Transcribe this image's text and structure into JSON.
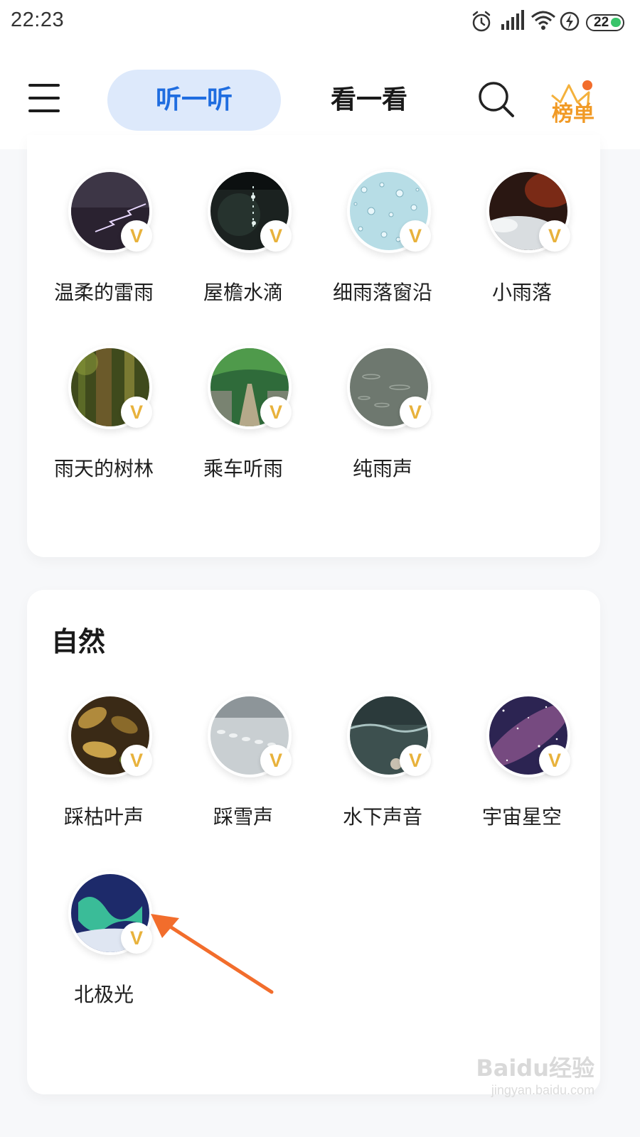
{
  "status_bar": {
    "time": "22:23",
    "battery_level": "22",
    "icons": [
      "alarm-icon",
      "signal-icon",
      "wifi-icon",
      "charging-icon",
      "battery-icon"
    ]
  },
  "header": {
    "menu_icon": "menu-icon",
    "tabs": [
      {
        "label": "听一听",
        "active": true
      },
      {
        "label": "看一看",
        "active": false
      }
    ],
    "search_icon": "search-icon",
    "rank_label": "榜单"
  },
  "rain_section": {
    "items": [
      {
        "label": "温柔的雷雨",
        "badge": "V"
      },
      {
        "label": "屋檐水滴",
        "badge": "V"
      },
      {
        "label": "细雨落窗沿",
        "badge": "V"
      },
      {
        "label": "小雨落",
        "badge": "V"
      },
      {
        "label": "雨天的树林",
        "badge": "V"
      },
      {
        "label": "乘车听雨",
        "badge": "V"
      },
      {
        "label": "纯雨声",
        "badge": "V"
      }
    ]
  },
  "nature_section": {
    "title": "自然",
    "items": [
      {
        "label": "踩枯叶声",
        "badge": "V"
      },
      {
        "label": "踩雪声",
        "badge": "V"
      },
      {
        "label": "水下声音",
        "badge": "V"
      },
      {
        "label": "宇宙星空",
        "badge": "V"
      },
      {
        "label": "北极光",
        "badge": "V"
      }
    ]
  },
  "annotation": {
    "arrow_color": "#f26d2c"
  },
  "watermark": {
    "text": "Baidu经验",
    "url": "jingyan.baidu.com"
  },
  "colors": {
    "accent": "#1f6de0",
    "tab_bg": "#dde9fb",
    "rank": "#f19a25",
    "badge": "#e8b23c"
  }
}
